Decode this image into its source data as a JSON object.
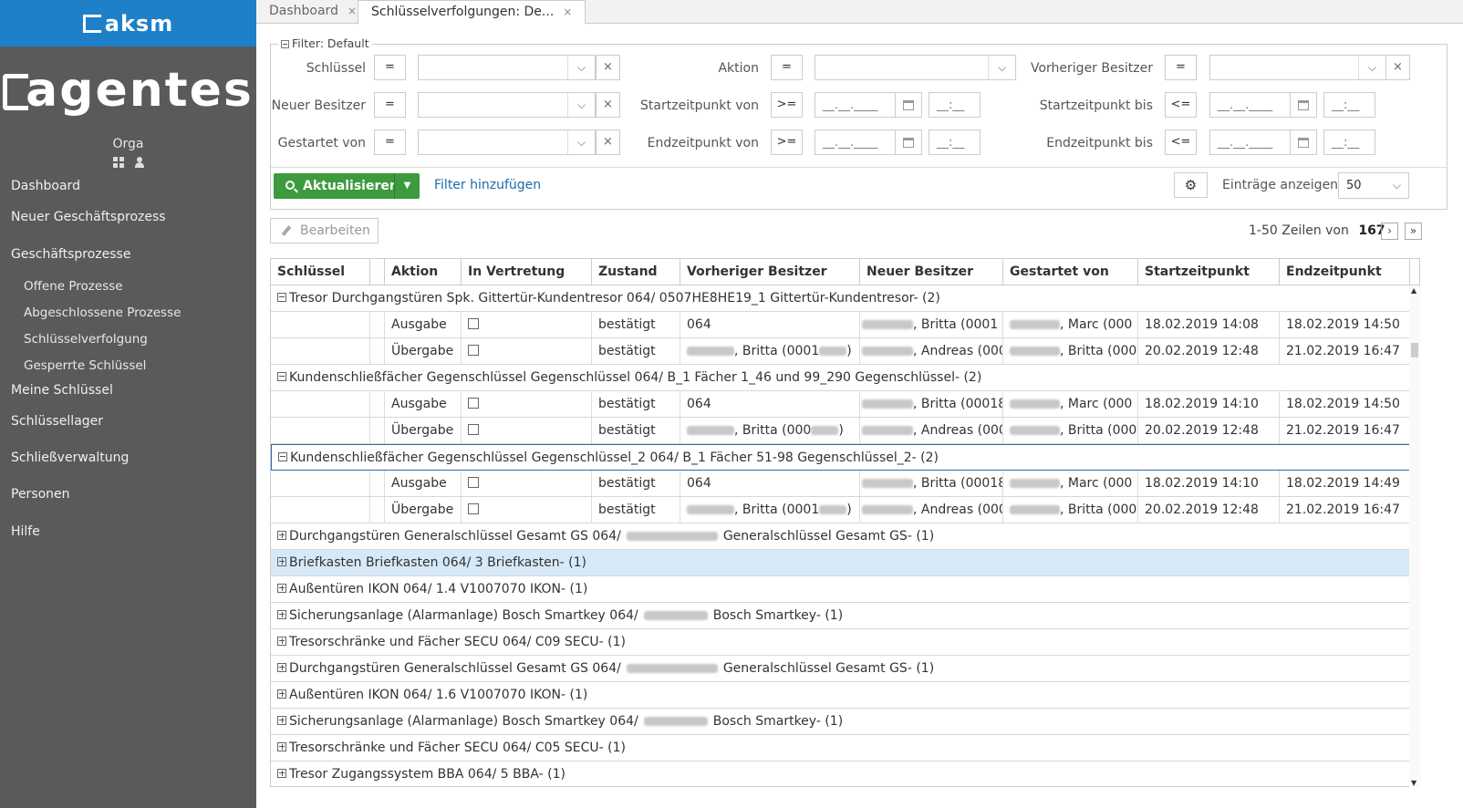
{
  "brand": {
    "top": "aksm",
    "logo": "agentes",
    "user": "Orga"
  },
  "sidebar": {
    "items": [
      {
        "label": "Dashboard"
      },
      {
        "label": "Neuer Geschäftsprozess"
      },
      {
        "label": "Geschäftsprozesse"
      },
      {
        "label": "Offene Prozesse"
      },
      {
        "label": "Abgeschlossene Prozesse"
      },
      {
        "label": "Schlüsselverfolgung"
      },
      {
        "label": "Gesperrte Schlüssel"
      },
      {
        "label": "Meine Schlüssel"
      },
      {
        "label": "Schlüssellager"
      },
      {
        "label": "Schließverwaltung"
      },
      {
        "label": "Personen"
      },
      {
        "label": "Hilfe"
      }
    ]
  },
  "tabs": [
    {
      "label": "Dashboard",
      "close": "×"
    },
    {
      "label": "Schlüsselverfolgungen: De...",
      "close": "×"
    }
  ],
  "filter": {
    "legend": "Filter: Default",
    "labels": {
      "schluessel": "Schlüssel",
      "aktion": "Aktion",
      "vorheriger": "Vorheriger Besitzer",
      "neuer": "Neuer Besitzer",
      "startvon": "Startzeitpunkt von",
      "startbis": "Startzeitpunkt bis",
      "gestartet": "Gestartet von",
      "endvon": "Endzeitpunkt von",
      "endbis": "Endzeitpunkt bis"
    },
    "ops": {
      "eq": "=",
      "gte": ">=",
      "lte": "<="
    },
    "date_placeholder": "__.__.____",
    "time_placeholder": "__:__",
    "clear": "×",
    "refresh": "Aktualisieren",
    "add_filter": "Filter hinzufügen",
    "entries_label": "Einträge anzeigen",
    "entries_value": "50"
  },
  "toolbar": {
    "edit": "Bearbeiten",
    "pager_text": "1-50 Zeilen von",
    "total": "167",
    "next": "›",
    "last": "»"
  },
  "table": {
    "headers": [
      "Schlüssel",
      "Aktion",
      "In Vertretung",
      "Zustand",
      "Vorheriger Besitzer",
      "Neuer Besitzer",
      "Gestartet von",
      "Startzeitpunkt",
      "Endzeitpunkt"
    ],
    "groups": [
      {
        "title": "Tresor Durchgangstüren Spk. Gittertür-Kundentresor 064/ 0507HE8HE19_1 Gittertür-Kundentresor- (2)",
        "rows": [
          {
            "aktion": "Ausgabe",
            "zustand": "bestätigt",
            "vorheriger": "064",
            "neuer": ", Britta (0001",
            "gestartet": ", Marc (000",
            "start": "18.02.2019 14:08",
            "end": "18.02.2019 14:50"
          },
          {
            "aktion": "Übergabe",
            "zustand": "bestätigt",
            "vorheriger": ", Britta (0001",
            "vorheriger_end": ")",
            "neuer": ", Andreas (000",
            "gestartet": ", Britta (000",
            "start": "20.02.2019 12:48",
            "end": "21.02.2019 16:47"
          }
        ]
      },
      {
        "title": "Kundenschließfächer Gegenschlüssel Gegenschlüssel 064/ B_1 Fächer 1_46 und 99_290 Gegenschlüssel- (2)",
        "rows": [
          {
            "aktion": "Ausgabe",
            "zustand": "bestätigt",
            "vorheriger": "064",
            "neuer": ", Britta (000186",
            "gestartet": ", Marc (000",
            "start": "18.02.2019 14:10",
            "end": "18.02.2019 14:50"
          },
          {
            "aktion": "Übergabe",
            "zustand": "bestätigt",
            "vorheriger": ", Britta (000",
            "vorheriger_end": ")",
            "neuer": ", Andreas (000",
            "gestartet": ", Britta (000",
            "start": "20.02.2019 12:48",
            "end": "21.02.2019 16:47"
          }
        ]
      },
      {
        "title": "Kundenschließfächer Gegenschlüssel Gegenschlüssel_2 064/ B_1 Fächer 51-98 Gegenschlüssel_2- (2)",
        "rows": [
          {
            "aktion": "Ausgabe",
            "zustand": "bestätigt",
            "vorheriger": "064",
            "neuer": ", Britta (000186",
            "gestartet": ", Marc (000",
            "start": "18.02.2019 14:10",
            "end": "18.02.2019 14:49"
          },
          {
            "aktion": "Übergabe",
            "zustand": "bestätigt",
            "vorheriger": ", Britta (0001",
            "vorheriger_end": ")",
            "neuer": ", Andreas (000",
            "gestartet": ", Britta (000",
            "start": "20.02.2019 12:48",
            "end": "21.02.2019 16:47"
          }
        ]
      }
    ],
    "collapsed": [
      {
        "pre": "Durchgangstüren Generalschlüssel Gesamt GS 064/",
        "post": "Generalschlüssel Gesamt GS- (1)"
      },
      {
        "pre": "Briefkasten Briefkasten 064/ 3 Briefkasten- (1)",
        "post": ""
      },
      {
        "pre": "Außentüren IKON 064/ 1.4 V1007070 IKON- (1)",
        "post": ""
      },
      {
        "pre": "Sicherungsanlage (Alarmanlage) Bosch Smartkey 064/",
        "post": "Bosch Smartkey- (1)"
      },
      {
        "pre": "Tresorschränke und Fächer SECU 064/ C09 SECU- (1)",
        "post": ""
      },
      {
        "pre": "Durchgangstüren Generalschlüssel Gesamt GS 064/",
        "post": "Generalschlüssel Gesamt GS- (1)"
      },
      {
        "pre": "Außentüren IKON 064/ 1.6 V1007070 IKON- (1)",
        "post": ""
      },
      {
        "pre": "Sicherungsanlage (Alarmanlage) Bosch Smartkey 064/",
        "post": "Bosch Smartkey- (1)"
      },
      {
        "pre": "Tresorschränke und Fächer SECU 064/ C05 SECU- (1)",
        "post": ""
      },
      {
        "pre": "Tresor Zugangssystem BBA 064/ 5 BBA- (1)",
        "post": ""
      }
    ]
  },
  "colors": {
    "sidebar": "#585a5c",
    "brand": "#1d80c9",
    "refresh": "#3d9a3d",
    "highlight": "#d6e9f8",
    "link": "#1c6aa8"
  }
}
